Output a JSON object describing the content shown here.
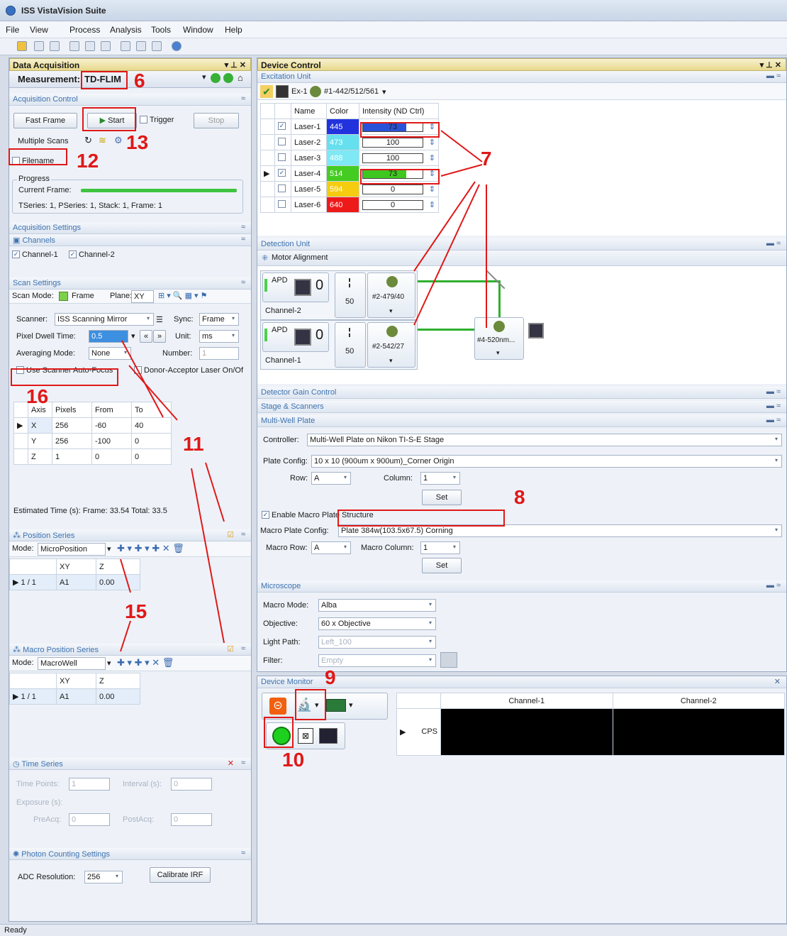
{
  "app": {
    "title": "ISS VistaVision Suite",
    "status": "Ready"
  },
  "menu": [
    "File",
    "View",
    "Process",
    "Analysis",
    "Tools",
    "Window",
    "Help"
  ],
  "data_acquisition": {
    "panel_title": "Data Acquisition",
    "measurement_label": "Measurement:",
    "measurement_value": "TD-FLIM",
    "acquisition_control": {
      "title": "Acquisition Control",
      "fast_frame": "Fast Frame",
      "start": "Start",
      "trigger": "Trigger",
      "stop": "Stop",
      "multiple_scans": "Multiple Scans",
      "filename": "Filename",
      "progress_label": "Progress",
      "current_frame": "Current Frame:",
      "progress_fraction": 1.0,
      "tseries": "TSeries: 1, PSeries: 1, Stack: 1, Frame: 1"
    },
    "acquisition_settings": {
      "title": "Acquisition Settings",
      "channels_title": "Channels",
      "channel1": "Channel-1",
      "channel2": "Channel-2"
    },
    "scan_settings": {
      "title": "Scan Settings",
      "scan_mode_label": "Scan Mode:",
      "scan_mode": "Frame",
      "plane_label": "Plane:",
      "plane": "XY",
      "scanner_label": "Scanner:",
      "scanner": "ISS Scanning Mirror",
      "sync_label": "Sync:",
      "sync": "Frame",
      "pixel_dwell_label": "Pixel Dwell Time:",
      "pixel_dwell": "0.5",
      "unit_label": "Unit:",
      "unit": "ms",
      "averaging_label": "Averaging Mode:",
      "averaging": "None",
      "number_label": "Number:",
      "number": "1",
      "autofocus": "Use Scanner Auto-Focus",
      "donor": "Donor-Acceptor Laser On/Of",
      "axis_headers": [
        "Axis",
        "Pixels",
        "From",
        "To"
      ],
      "axis_rows": [
        [
          "X",
          "256",
          "-60",
          "40"
        ],
        [
          "Y",
          "256",
          "-100",
          "0"
        ],
        [
          "Z",
          "1",
          "0",
          "0"
        ]
      ],
      "estimated": "Estimated Time (s):   Frame:  33.54  Total:  33.5"
    },
    "position_series": {
      "title": "Position Series",
      "mode_label": "Mode:",
      "mode": "MicroPosition",
      "headers": [
        "",
        "XY",
        "Z"
      ],
      "row": [
        "1 / 1",
        "A1",
        "0.00"
      ]
    },
    "macro_position_series": {
      "title": "Macro Position Series",
      "mode_label": "Mode:",
      "mode": "MacroWell",
      "headers": [
        "",
        "XY",
        "Z"
      ],
      "row": [
        "1 / 1",
        "A1",
        "0.00"
      ]
    },
    "time_series": {
      "title": "Time Series",
      "time_points_label": "Time Points:",
      "time_points": "1",
      "interval_label": "Interval (s):",
      "interval": "0",
      "exposure_label": "Exposure (s):",
      "preacq_label": "PreAcq:",
      "preacq": "0",
      "postacq_label": "PostAcq:",
      "postacq": "0"
    },
    "photon_counting": {
      "title": "Photon Counting Settings",
      "adc_label": "ADC Resolution:",
      "adc": "256",
      "calibrate": "Calibrate IRF"
    }
  },
  "device_control": {
    "panel_title": "Device Control",
    "excitation_unit": {
      "title": "Excitation Unit",
      "ex_label": "Ex-1",
      "filter": "#1-442/512/561",
      "headers": [
        "Name",
        "Color",
        "Intensity (ND Ctrl)"
      ],
      "lasers": [
        {
          "name": "Laser-1",
          "color_value": "445",
          "color": "#2233dd",
          "intensity": "73",
          "checked": true,
          "fill": 0.73,
          "bar": "#2a52d8"
        },
        {
          "name": "Laser-2",
          "color_value": "473",
          "color": "#66e0ee",
          "intensity": "100",
          "checked": false,
          "fill": 0,
          "bar": "#2a52d8"
        },
        {
          "name": "Laser-3",
          "color_value": "488",
          "color": "#7ee8f4",
          "intensity": "100",
          "checked": false,
          "fill": 0,
          "bar": "#2a52d8"
        },
        {
          "name": "Laser-4",
          "color_value": "514",
          "color": "#44cc22",
          "intensity": "73",
          "checked": true,
          "fill": 0.73,
          "bar": "#3ec81f"
        },
        {
          "name": "Laser-5",
          "color_value": "594",
          "color": "#f5cc10",
          "intensity": "0",
          "checked": false,
          "fill": 0,
          "bar": "#2a52d8"
        },
        {
          "name": "Laser-6",
          "color_value": "640",
          "color": "#ee1a1a",
          "intensity": "0",
          "checked": false,
          "fill": 0,
          "bar": "#2a52d8"
        }
      ]
    },
    "detection_unit": {
      "title": "Detection Unit",
      "motor_alignment": "Motor Alignment",
      "apd": "APD",
      "channel2": "Channel-2",
      "channel1": "Channel-1",
      "pinhole": "50",
      "filter2": "#2-479/40",
      "filter1": "#2-542/27",
      "filter4": "#4-520nm..."
    },
    "detector_gain": "Detector Gain Control",
    "stage_scanners": "Stage & Scanners",
    "multi_well": {
      "title": "Multi-Well Plate",
      "controller_label": "Controller:",
      "controller": "Multi-Well Plate on Nikon TI-S-E Stage",
      "plate_config_label": "Plate Config:",
      "plate_config": "10 x 10 (900um x 900um)_Corner Origin",
      "row_label": "Row:",
      "row": "A",
      "column_label": "Column:",
      "column": "1",
      "set": "Set",
      "enable_macro": "Enable Macro Plate Structure",
      "macro_config_label": "Macro Plate Config:",
      "macro_config": "Plate 384w(103.5x67.5) Corning",
      "macro_row_label": "Macro Row:",
      "macro_row": "A",
      "macro_col_label": "Macro Column:",
      "macro_col": "1",
      "set2": "Set"
    },
    "microscope": {
      "title": "Microscope",
      "macro_mode_label": "Macro Mode:",
      "macro_mode": "Alba",
      "objective_label": "Objective:",
      "objective": "60 x Objective",
      "light_path_label": "Light Path:",
      "light_path": "Left_100",
      "filter_label": "Filter:",
      "filter": "Empty"
    }
  },
  "device_monitor": {
    "title": "Device Monitor",
    "col1": "Channel-1",
    "col2": "Channel-2",
    "row_label": "CPS"
  },
  "annotations": [
    "6",
    "12",
    "13",
    "16",
    "11",
    "15",
    "7",
    "8",
    "9",
    "10"
  ]
}
